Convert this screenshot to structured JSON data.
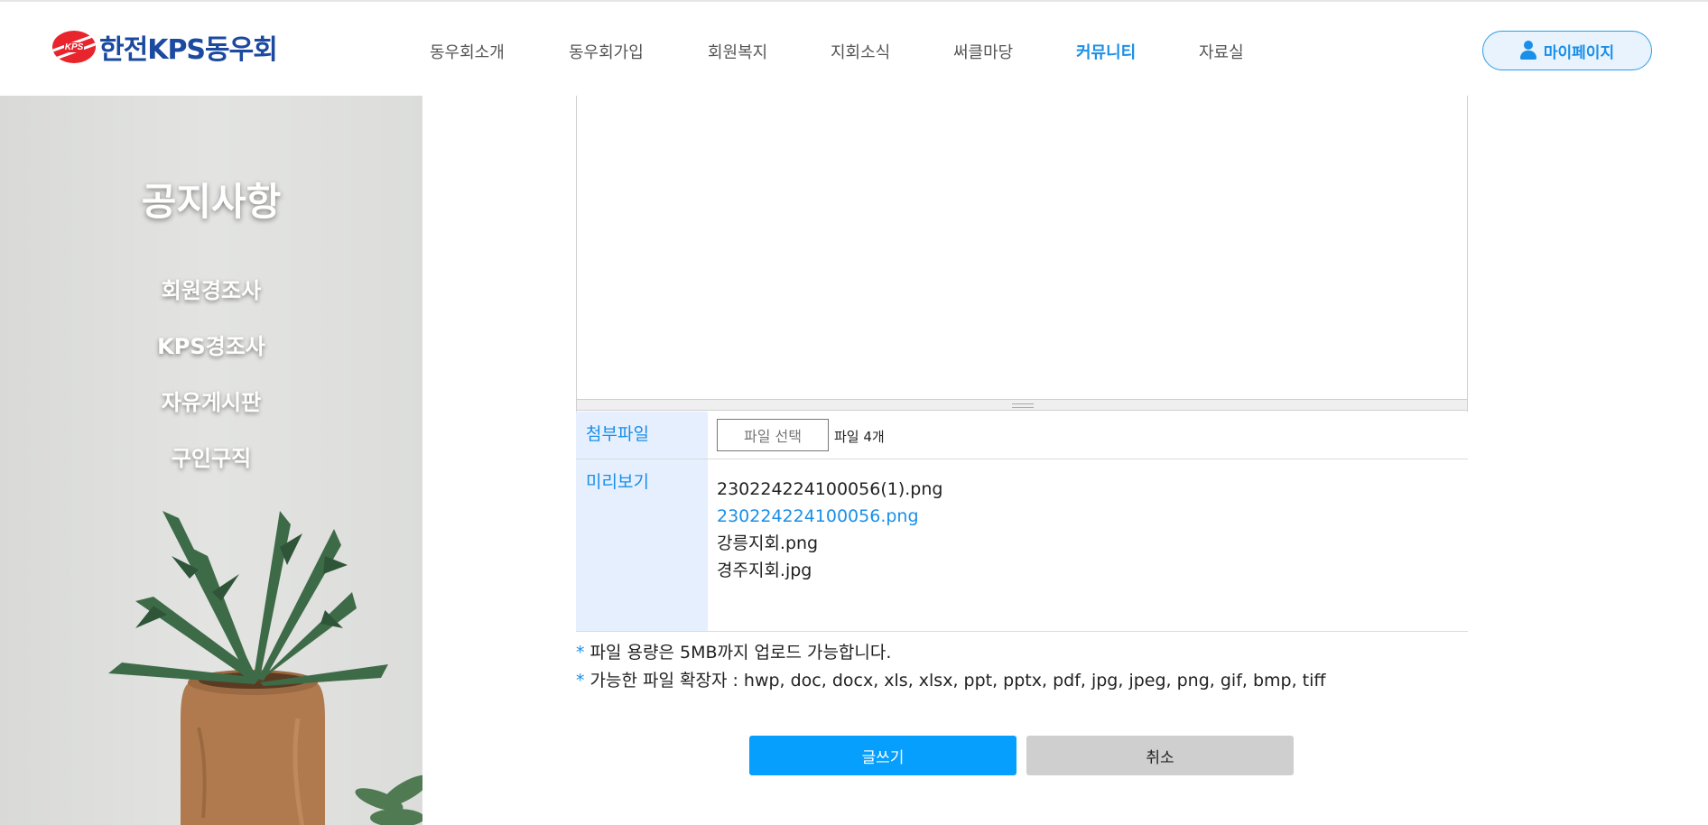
{
  "header": {
    "logo_mark_text": "KPS",
    "logo_text": "한전KPS동우회",
    "nav": [
      {
        "label": "동우회소개",
        "active": false
      },
      {
        "label": "동우회가입",
        "active": false
      },
      {
        "label": "회원복지",
        "active": false
      },
      {
        "label": "지회소식",
        "active": false
      },
      {
        "label": "써클마당",
        "active": false
      },
      {
        "label": "커뮤니티",
        "active": true
      },
      {
        "label": "자료실",
        "active": false
      }
    ],
    "mypage_label": "마이페이지",
    "mypage_icon": "user-icon"
  },
  "sidebar": {
    "title": "공지사항",
    "items": [
      {
        "label": "회원경조사"
      },
      {
        "label": "KPS경조사"
      },
      {
        "label": "자유게시판"
      },
      {
        "label": "구인구직"
      }
    ]
  },
  "form": {
    "attach_label": "첨부파일",
    "file_button_label": "파일 선택",
    "file_count_text": "파일 4개",
    "preview_label": "미리보기",
    "preview_files": [
      {
        "name": "230224224100056(1).png",
        "link": false
      },
      {
        "name": "230224224100056.png",
        "link": true
      },
      {
        "name": "강릉지회.png",
        "link": false
      },
      {
        "name": "경주지회.jpg",
        "link": false
      }
    ],
    "note_star": "*",
    "notes": [
      "파일 용량은 5MB까지 업로드 가능합니다.",
      "가능한 파일 확장자 : hwp, doc, docx, xls, xlsx, ppt, pptx, pdf, jpg, jpeg, png, gif, bmp, tiff"
    ],
    "submit_label": "글쓰기",
    "cancel_label": "취소"
  },
  "colors": {
    "accent": "#1a8fe8",
    "primary_button": "#069ffd",
    "secondary_button": "#cfcfcf",
    "label_bg": "#e6effd",
    "logo_blue": "#1b4aa0",
    "logo_red": "#e8242c"
  }
}
